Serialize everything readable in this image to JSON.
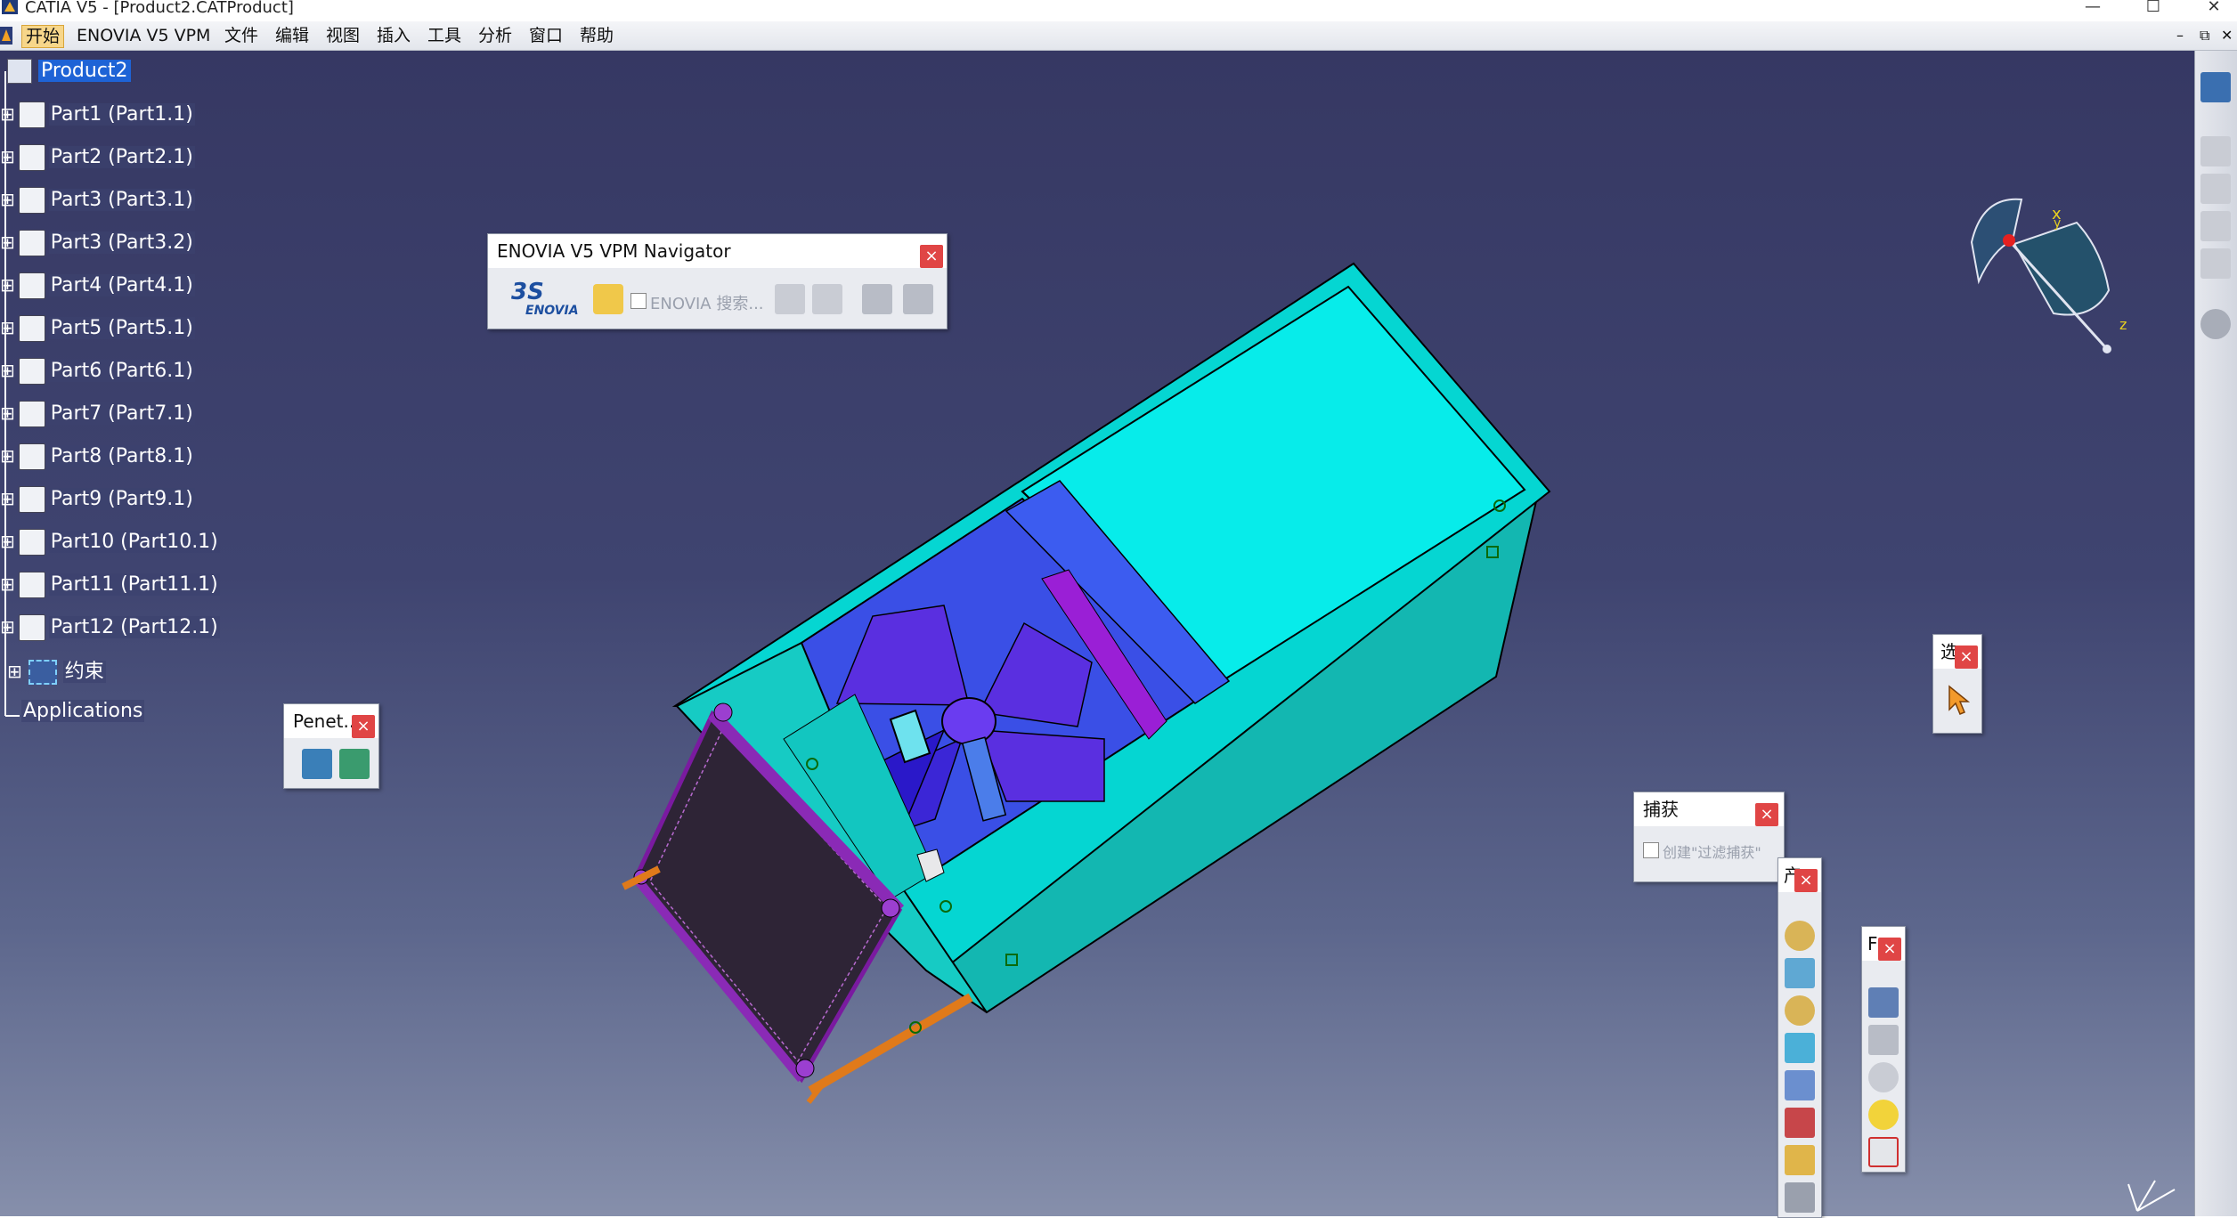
{
  "window": {
    "title": "CATIA V5 - [Product2.CATProduct]",
    "controls": [
      "—",
      "☐",
      "✕"
    ],
    "mdi_controls": [
      "–",
      "⧉",
      "✕"
    ]
  },
  "menubar": {
    "items": [
      {
        "label": "开始",
        "active": true
      },
      {
        "label": "ENOVIA V5 VPM"
      },
      {
        "label": "文件"
      },
      {
        "label": "编辑"
      },
      {
        "label": "视图"
      },
      {
        "label": "插入"
      },
      {
        "label": "工具"
      },
      {
        "label": "分析"
      },
      {
        "label": "窗口"
      },
      {
        "label": "帮助"
      }
    ]
  },
  "tree": {
    "root": "Product2",
    "items": [
      "Part1 (Part1.1)",
      "Part2 (Part2.1)",
      "Part3 (Part3.1)",
      "Part3 (Part3.2)",
      "Part4 (Part4.1)",
      "Part5 (Part5.1)",
      "Part6 (Part6.1)",
      "Part7 (Part7.1)",
      "Part8 (Part8.1)",
      "Part9 (Part9.1)",
      "Part10 (Part10.1)",
      "Part11 (Part11.1)",
      "Part12 (Part12.1)"
    ],
    "constraints": "约束",
    "applications": "Applications"
  },
  "enovia_panel": {
    "title": "ENOVIA V5 VPM Navigator",
    "logo_text": "ENOVIA",
    "search_label": "ENOVIA 搜索..."
  },
  "penet_panel": {
    "title": "Penet..."
  },
  "capture_panel": {
    "title": "捕获",
    "checkbox_label": "创建\"过滤捕获\""
  },
  "select_panel": {
    "title": "选"
  },
  "toolbar2": {
    "title": "产"
  },
  "toolbar3": {
    "title": "F"
  },
  "compass": {
    "x": "x",
    "y": "y",
    "z": "z"
  },
  "close_glyph": "×",
  "colors": {
    "viewport_top": "#363863",
    "viewport_bottom": "#868fab",
    "housing": "#17c9c2",
    "housing_top": "#07ecea",
    "fan_blade": "#5a2fe0",
    "radiator": "#7a1aa0",
    "pipe": "#e07a1a"
  }
}
